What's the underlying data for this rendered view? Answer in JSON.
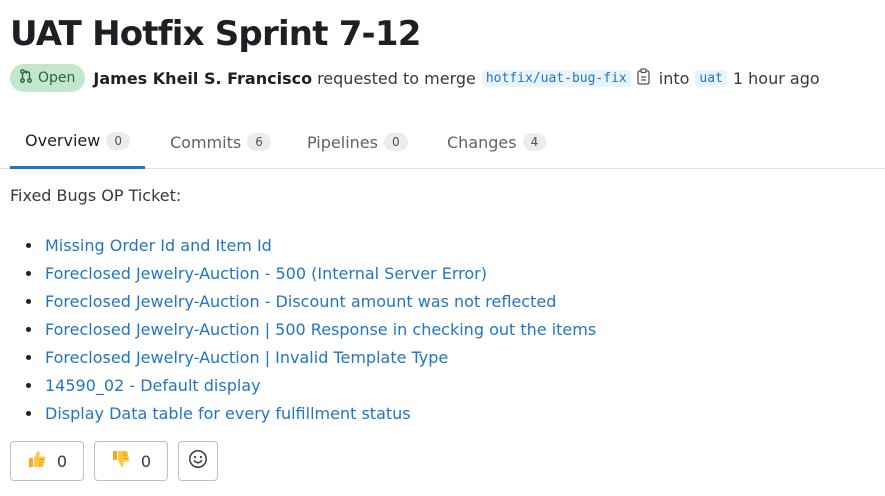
{
  "mr": {
    "title": "UAT Hotfix Sprint 7-12",
    "status": "Open",
    "author": "James Kheil S. Francisco",
    "action": "requested to merge",
    "source_branch": "hotfix/uat-bug-fix",
    "into": "into",
    "target_branch": "uat",
    "time": "1 hour ago"
  },
  "tabs": [
    {
      "label": "Overview",
      "count": "0"
    },
    {
      "label": "Commits",
      "count": "6"
    },
    {
      "label": "Pipelines",
      "count": "0"
    },
    {
      "label": "Changes",
      "count": "4"
    }
  ],
  "description": {
    "heading": "Fixed Bugs OP Ticket:",
    "items": [
      "Missing Order Id and Item Id",
      "Foreclosed Jewelry-Auction - 500 (Internal Server Error)",
      "Foreclosed Jewelry-Auction - Discount amount was not reflected",
      "Foreclosed Jewelry-Auction | 500 Response in checking out the items",
      "Foreclosed Jewelry-Auction | Invalid Template Type",
      "14590_02 - Default display",
      "Display Data table for every fulfillment status"
    ]
  },
  "reactions": {
    "thumbs_up": "0",
    "thumbs_down": "0",
    "thumbs_up_icon": "thumbs-up-icon",
    "thumbs_down_icon": "thumbs-down-icon",
    "emoji_icon": "smiley-face-icon"
  },
  "colors": {
    "accent": "#1f75cb",
    "badge_bg": "#c3e6cd",
    "badge_text": "#24663b"
  }
}
